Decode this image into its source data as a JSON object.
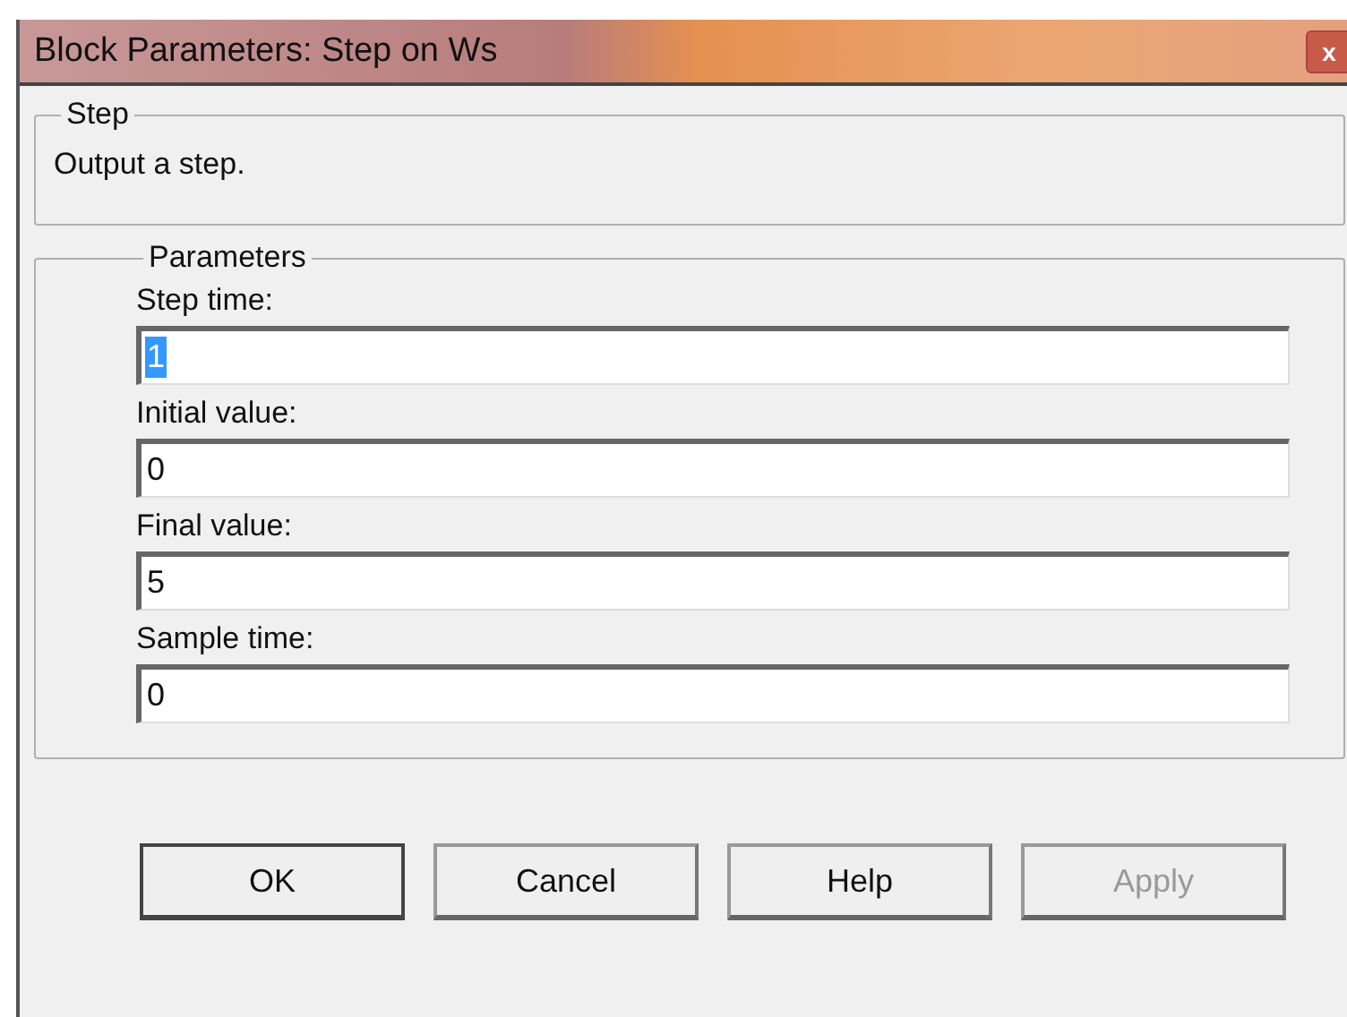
{
  "window": {
    "title": "Block Parameters: Step on Ws",
    "close": "x"
  },
  "description_group": {
    "title": "Step",
    "text": "Output a step."
  },
  "parameters_group": {
    "title": "Parameters",
    "fields": [
      {
        "label": "Step time:",
        "value": "1",
        "text_selected": true
      },
      {
        "label": "Initial value:",
        "value": "0",
        "text_selected": false
      },
      {
        "label": "Final value:",
        "value": "5",
        "text_selected": false
      },
      {
        "label": "Sample time:",
        "value": "0",
        "text_selected": false
      }
    ]
  },
  "buttons": [
    {
      "label": "OK",
      "disabled": false,
      "default": true
    },
    {
      "label": "Cancel",
      "disabled": false,
      "default": false
    },
    {
      "label": "Help",
      "disabled": false,
      "default": false
    },
    {
      "label": "Apply",
      "disabled": true,
      "default": false
    }
  ]
}
